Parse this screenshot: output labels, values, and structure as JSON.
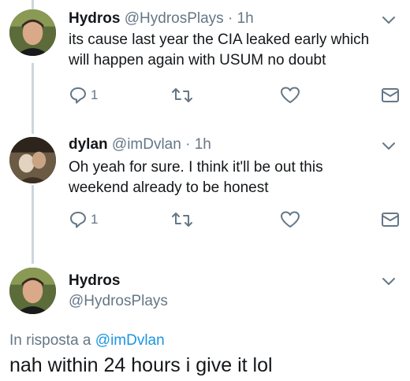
{
  "tweets": [
    {
      "name": "Hydros",
      "handle": "@HydrosPlays",
      "dot": "·",
      "time": "1h",
      "text_line1": "its cause last year the CIA leaked early which",
      "text_line2": "will happen again with USUM no doubt",
      "reply_count": "1"
    },
    {
      "name": "dylan",
      "handle": "@imDvlan",
      "dot": "·",
      "time": "1h",
      "text_line1": "Oh yeah for sure. I think it'll be out this",
      "text_line2": "weekend already to be honest",
      "reply_count": "1"
    }
  ],
  "main_tweet": {
    "name": "Hydros",
    "handle": "@HydrosPlays",
    "reply_prefix": "In risposta a",
    "reply_mention": "@imDvlan",
    "text": "nah within 24 hours i give it lol"
  },
  "icons": {
    "reply": "reply-icon",
    "retweet": "retweet-icon",
    "like": "heart-icon",
    "dm": "envelope-icon",
    "caret": "chevron-down-icon"
  },
  "colors": {
    "text": "#14171a",
    "secondary": "#657786",
    "link": "#1b95e0",
    "thread_line": "#ccd6dd"
  }
}
